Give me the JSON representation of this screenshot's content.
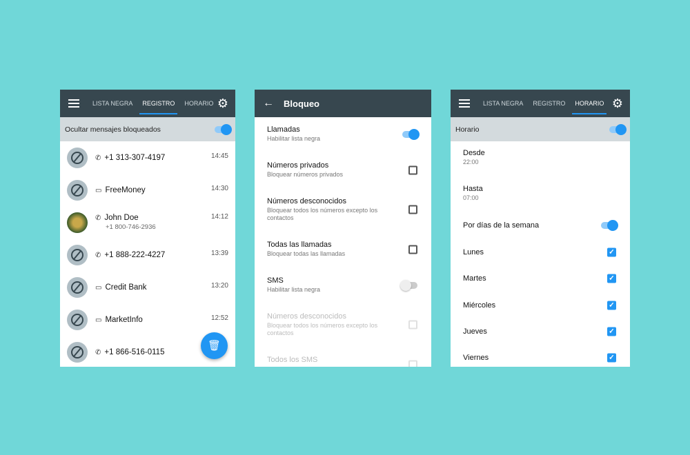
{
  "colors": {
    "background": "#70d7d8",
    "header": "#37474f",
    "accent": "#2196f3"
  },
  "screen1": {
    "tabs": [
      "LISTA NEGRA",
      "REGISTRO",
      "HORARIO"
    ],
    "active_tab": "REGISTRO",
    "toggle_label": "Ocultar mensajes bloqueados",
    "toggle_on": true,
    "items": [
      {
        "type": "call",
        "name": "+1 313-307-4197",
        "time": "14:45"
      },
      {
        "type": "sms",
        "name": "FreeMoney",
        "time": "14:30"
      },
      {
        "type": "call",
        "name": "John Doe",
        "number": "+1 800-746-2936",
        "time": "14:12"
      },
      {
        "type": "call",
        "name": "+1 888-222-4227",
        "time": "13:39"
      },
      {
        "type": "sms",
        "name": "Credit Bank",
        "time": "13:20"
      },
      {
        "type": "sms",
        "name": "MarketInfo",
        "time": "12:52"
      },
      {
        "type": "call",
        "name": "+1 866-516-0115",
        "time": ""
      }
    ],
    "fab_icon": "trash-icon"
  },
  "screen2": {
    "title": "Bloqueo",
    "settings": [
      {
        "title": "Llamadas",
        "subtitle": "Habilitar lista negra",
        "control": "switch",
        "on": true
      },
      {
        "title": "Números privados",
        "subtitle": "Bloquear números privados",
        "control": "checkbox",
        "on": false
      },
      {
        "title": "Números desconocidos",
        "subtitle": "Bloquear todos los números excepto los contactos",
        "control": "checkbox",
        "on": false
      },
      {
        "title": "Todas las llamadas",
        "subtitle": "Bloquear todas las llamadas",
        "control": "checkbox",
        "on": false
      },
      {
        "title": "SMS",
        "subtitle": "Habilitar lista negra",
        "control": "switch",
        "on": false
      },
      {
        "title": "Números desconocidos",
        "subtitle": "Bloquear todos los números excepto los contactos",
        "control": "checkbox",
        "on": false,
        "disabled": true
      },
      {
        "title": "Todos los SMS",
        "subtitle": "",
        "control": "checkbox",
        "on": false,
        "disabled": true
      }
    ]
  },
  "screen3": {
    "tabs": [
      "LISTA NEGRA",
      "REGISTRO",
      "HORARIO"
    ],
    "active_tab": "HORARIO",
    "toggle_label": "Horario",
    "toggle_on": true,
    "from_label": "Desde",
    "from_value": "22:00",
    "to_label": "Hasta",
    "to_value": "07:00",
    "weekdays_label": "Por días de la semana",
    "weekdays_on": true,
    "days": [
      {
        "name": "Lunes",
        "checked": true
      },
      {
        "name": "Martes",
        "checked": true
      },
      {
        "name": "Miércoles",
        "checked": true
      },
      {
        "name": "Jueves",
        "checked": true
      },
      {
        "name": "Viernes",
        "checked": true
      }
    ]
  }
}
